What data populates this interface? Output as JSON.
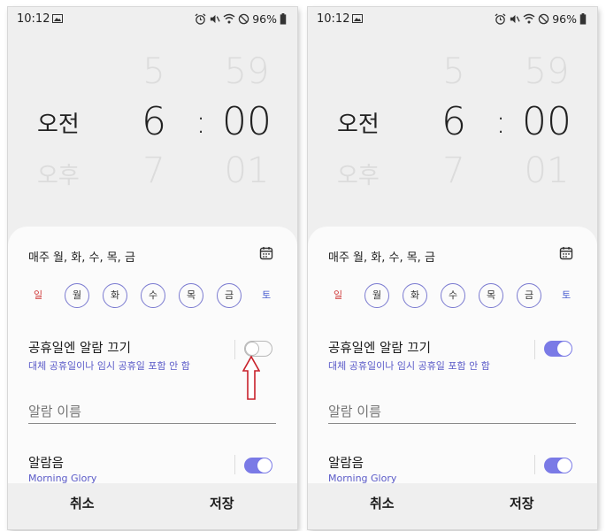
{
  "panels": [
    {
      "status": {
        "time": "10:12",
        "battery": "96%"
      },
      "picker": {
        "ampm_current": "오전",
        "ampm_next": "오후",
        "hour_prev": "5",
        "hour_current": "6",
        "hour_next": "7",
        "colon": ":",
        "minute_prev": "59",
        "minute_current": "00",
        "minute_next": "01"
      },
      "repeat_label": "매주 월, 화, 수, 목, 금",
      "days": [
        "일",
        "월",
        "화",
        "수",
        "목",
        "금",
        "토"
      ],
      "holiday": {
        "title": "공휴일엔 알람 끄기",
        "subtitle": "대체 공휴일이나 임시 공휴일 포함 안 함",
        "enabled": false
      },
      "alarm_name_placeholder": "알람 이름",
      "sound": {
        "title": "알람음",
        "subtitle": "Morning Glory",
        "enabled": true
      },
      "footer": {
        "cancel": "취소",
        "save": "저장"
      }
    },
    {
      "status": {
        "time": "10:12",
        "battery": "96%"
      },
      "picker": {
        "ampm_current": "오전",
        "ampm_next": "오후",
        "hour_prev": "5",
        "hour_current": "6",
        "hour_next": "7",
        "colon": ":",
        "minute_prev": "59",
        "minute_current": "00",
        "minute_next": "01"
      },
      "repeat_label": "매주 월, 화, 수, 목, 금",
      "days": [
        "일",
        "월",
        "화",
        "수",
        "목",
        "금",
        "토"
      ],
      "holiday": {
        "title": "공휴일엔 알람 끄기",
        "subtitle": "대체 공휴일이나 임시 공휴일 포함 안 함",
        "enabled": true
      },
      "alarm_name_placeholder": "알람 이름",
      "sound": {
        "title": "알람음",
        "subtitle": "Morning Glory",
        "enabled": true
      },
      "footer": {
        "cancel": "취소",
        "save": "저장"
      }
    }
  ],
  "colors": {
    "accent": "#7a7ae6",
    "sunday": "#d03a3a",
    "saturday": "#4a5fd0",
    "annotation_arrow": "#c8202a"
  }
}
